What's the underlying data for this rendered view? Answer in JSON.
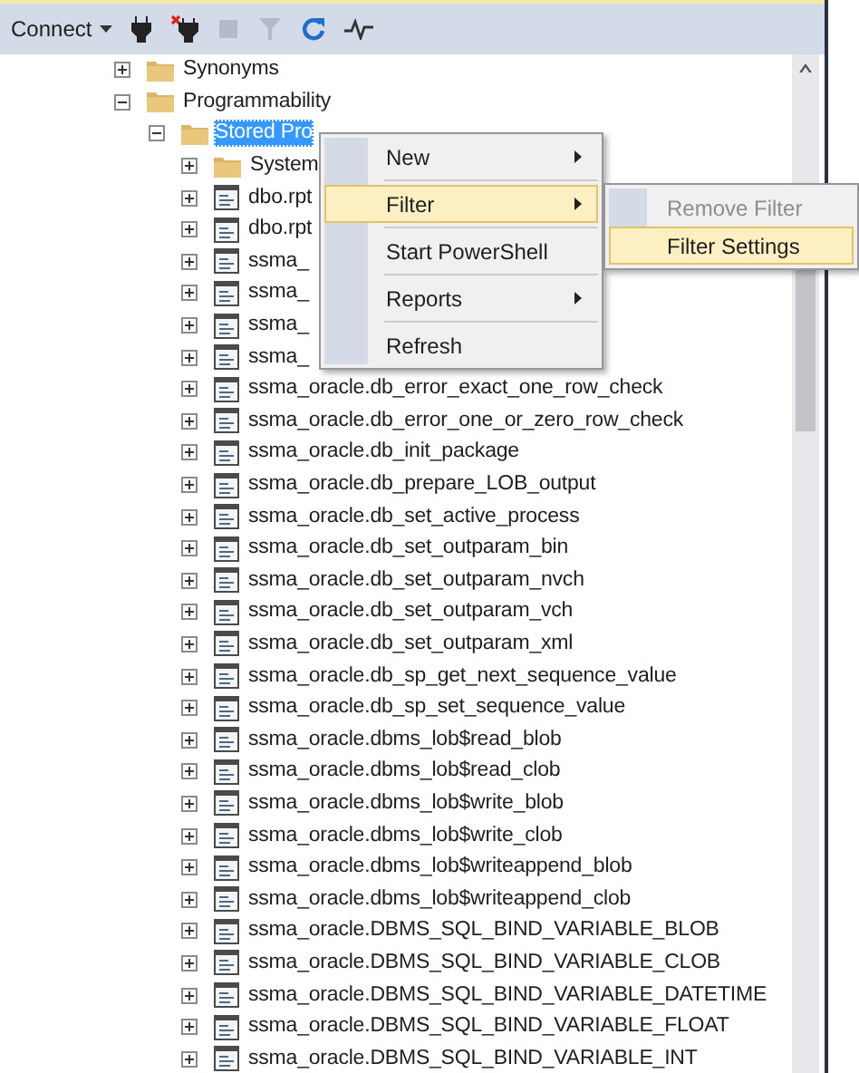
{
  "toolbar": {
    "connect": {
      "label": "Connect"
    },
    "tools": [
      {
        "kind": "plug",
        "disabled": false
      },
      {
        "kind": "disconnect",
        "disabled": false
      },
      {
        "kind": "stop",
        "disabled": true
      },
      {
        "kind": "filter",
        "disabled": true
      },
      {
        "kind": "refresh",
        "disabled": false
      },
      {
        "kind": "activity",
        "disabled": false
      }
    ]
  },
  "tree": [
    {
      "label": "Synonyms",
      "kind": "folder",
      "expanded": false,
      "selected": false
    },
    {
      "label": "Programmability",
      "kind": "folder",
      "expanded": true,
      "selected": false,
      "children": [
        {
          "label": "Stored Pro",
          "kind": "folder",
          "expanded": true,
          "selected": true,
          "children": [
            {
              "label": "System",
              "kind": "folder",
              "expanded": false,
              "selected": false
            },
            {
              "label": "dbo.rpt",
              "kind": "procedure",
              "expanded": false,
              "selected": false
            },
            {
              "label": "dbo.rpt",
              "kind": "procedure",
              "expanded": false,
              "selected": false
            },
            {
              "label": "ssma_",
              "kind": "procedure",
              "expanded": false,
              "selected": false
            },
            {
              "label": "ssma_",
              "kind": "procedure",
              "expanded": false,
              "selected": false
            },
            {
              "label": "ssma_",
              "kind": "procedure",
              "expanded": false,
              "selected": false
            },
            {
              "label": "ssma_",
              "kind": "procedure",
              "expanded": false,
              "selected": false
            },
            {
              "label": "ssma_oracle.db_error_exact_one_row_check",
              "kind": "procedure",
              "expanded": false,
              "selected": false
            },
            {
              "label": "ssma_oracle.db_error_one_or_zero_row_check",
              "kind": "procedure",
              "expanded": false,
              "selected": false
            },
            {
              "label": "ssma_oracle.db_init_package",
              "kind": "procedure",
              "expanded": false,
              "selected": false
            },
            {
              "label": "ssma_oracle.db_prepare_LOB_output",
              "kind": "procedure",
              "expanded": false,
              "selected": false
            },
            {
              "label": "ssma_oracle.db_set_active_process",
              "kind": "procedure",
              "expanded": false,
              "selected": false
            },
            {
              "label": "ssma_oracle.db_set_outparam_bin",
              "kind": "procedure",
              "expanded": false,
              "selected": false
            },
            {
              "label": "ssma_oracle.db_set_outparam_nvch",
              "kind": "procedure",
              "expanded": false,
              "selected": false
            },
            {
              "label": "ssma_oracle.db_set_outparam_vch",
              "kind": "procedure",
              "expanded": false,
              "selected": false
            },
            {
              "label": "ssma_oracle.db_set_outparam_xml",
              "kind": "procedure",
              "expanded": false,
              "selected": false
            },
            {
              "label": "ssma_oracle.db_sp_get_next_sequence_value",
              "kind": "procedure",
              "expanded": false,
              "selected": false
            },
            {
              "label": "ssma_oracle.db_sp_set_sequence_value",
              "kind": "procedure",
              "expanded": false,
              "selected": false
            },
            {
              "label": "ssma_oracle.dbms_lob$read_blob",
              "kind": "procedure",
              "expanded": false,
              "selected": false
            },
            {
              "label": "ssma_oracle.dbms_lob$read_clob",
              "kind": "procedure",
              "expanded": false,
              "selected": false
            },
            {
              "label": "ssma_oracle.dbms_lob$write_blob",
              "kind": "procedure",
              "expanded": false,
              "selected": false
            },
            {
              "label": "ssma_oracle.dbms_lob$write_clob",
              "kind": "procedure",
              "expanded": false,
              "selected": false
            },
            {
              "label": "ssma_oracle.dbms_lob$writeappend_blob",
              "kind": "procedure",
              "expanded": false,
              "selected": false
            },
            {
              "label": "ssma_oracle.dbms_lob$writeappend_clob",
              "kind": "procedure",
              "expanded": false,
              "selected": false
            },
            {
              "label": "ssma_oracle.DBMS_SQL_BIND_VARIABLE_BLOB",
              "kind": "procedure",
              "expanded": false,
              "selected": false
            },
            {
              "label": "ssma_oracle.DBMS_SQL_BIND_VARIABLE_CLOB",
              "kind": "procedure",
              "expanded": false,
              "selected": false
            },
            {
              "label": "ssma_oracle.DBMS_SQL_BIND_VARIABLE_DATETIME",
              "kind": "procedure",
              "expanded": false,
              "selected": false
            },
            {
              "label": "ssma_oracle.DBMS_SQL_BIND_VARIABLE_FLOAT",
              "kind": "procedure",
              "expanded": false,
              "selected": false
            },
            {
              "label": "ssma_oracle.DBMS_SQL_BIND_VARIABLE_INT",
              "kind": "procedure",
              "expanded": false,
              "selected": false
            }
          ]
        }
      ]
    }
  ],
  "context_menu": {
    "items": [
      {
        "label": "New",
        "has_submenu": true,
        "selected": false
      },
      {
        "label": "Filter",
        "has_submenu": true,
        "selected": true
      },
      {
        "label": "Start PowerShell",
        "has_submenu": false,
        "selected": false
      },
      {
        "label": "Reports",
        "has_submenu": true,
        "selected": false
      },
      {
        "label": "Refresh",
        "has_submenu": false,
        "selected": false
      }
    ]
  },
  "submenu": {
    "items": [
      {
        "label": "Remove Filter",
        "disabled": true,
        "selected": false
      },
      {
        "label": "Filter Settings",
        "disabled": false,
        "selected": true
      }
    ]
  }
}
